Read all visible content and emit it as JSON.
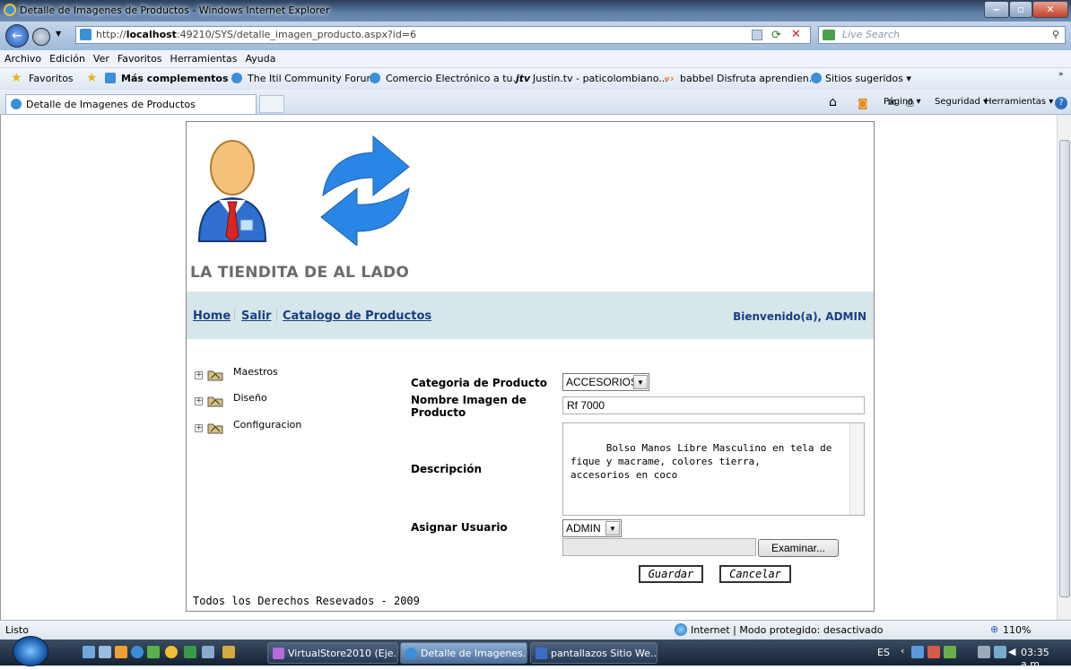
{
  "window": {
    "title": "Detalle de Imagenes de Productos - Windows Internet Explorer"
  },
  "address": {
    "url_prefix": "http://",
    "url_host": "localhost",
    "url_rest": ":49210/SYS/detalle_imagen_producto.aspx?id=6",
    "search_placeholder": "Live Search"
  },
  "menu": [
    "Archivo",
    "Edición",
    "Ver",
    "Favoritos",
    "Herramientas",
    "Ayuda"
  ],
  "favorites": {
    "favoritos": "Favoritos",
    "mas": "Más complementos ▾",
    "links": [
      "The Itil Community Forum",
      "Comercio Electrónico a tu...",
      "Justin.tv - paticolombiano...",
      "babbel Disfruta aprendien...",
      "Sitios sugeridos ▾"
    ]
  },
  "tab": {
    "label": "Detalle de Imagenes de Productos"
  },
  "commandbar": {
    "pagina": "Página ▾",
    "seguridad": "Seguridad ▾",
    "herramientas": "Herramientas ▾"
  },
  "site": {
    "store_name": "LA TIENDITA DE AL LADO",
    "nav": [
      "Home",
      "Salir",
      "Catalogo de Productos"
    ],
    "welcome": "Bienvenido(a), ADMIN",
    "tree": [
      "Maestros",
      "Diseño",
      "Configuracion"
    ],
    "form": {
      "categoria_label": "Categoria de Producto",
      "categoria_value": "ACCESORIOS",
      "nombre_label": "Nombre Imagen de Producto",
      "nombre_value": "Rf 7000",
      "descripcion_label": "Descripción",
      "descripcion_value": "Bolso Manos Libre Masculino en tela de\nfique y macrame, colores tierra,\naccesorios en coco",
      "usuario_label": "Asignar Usuario",
      "usuario_value": "ADMIN",
      "examinar": "Examinar...",
      "guardar": "Guardar",
      "cancelar": "Cancelar"
    },
    "footer": "Todos los Derechos Resevados - 2009"
  },
  "status": {
    "left": "Listo",
    "zone": "Internet | Modo protegido: desactivado",
    "zoom": "110%"
  },
  "taskbar": {
    "buttons": [
      "VirtualStore2010 (Eje...",
      "Detalle de Imagenes...",
      "pantallazos Sitio We..."
    ],
    "lang": "ES",
    "time": "03:35 a.m."
  }
}
